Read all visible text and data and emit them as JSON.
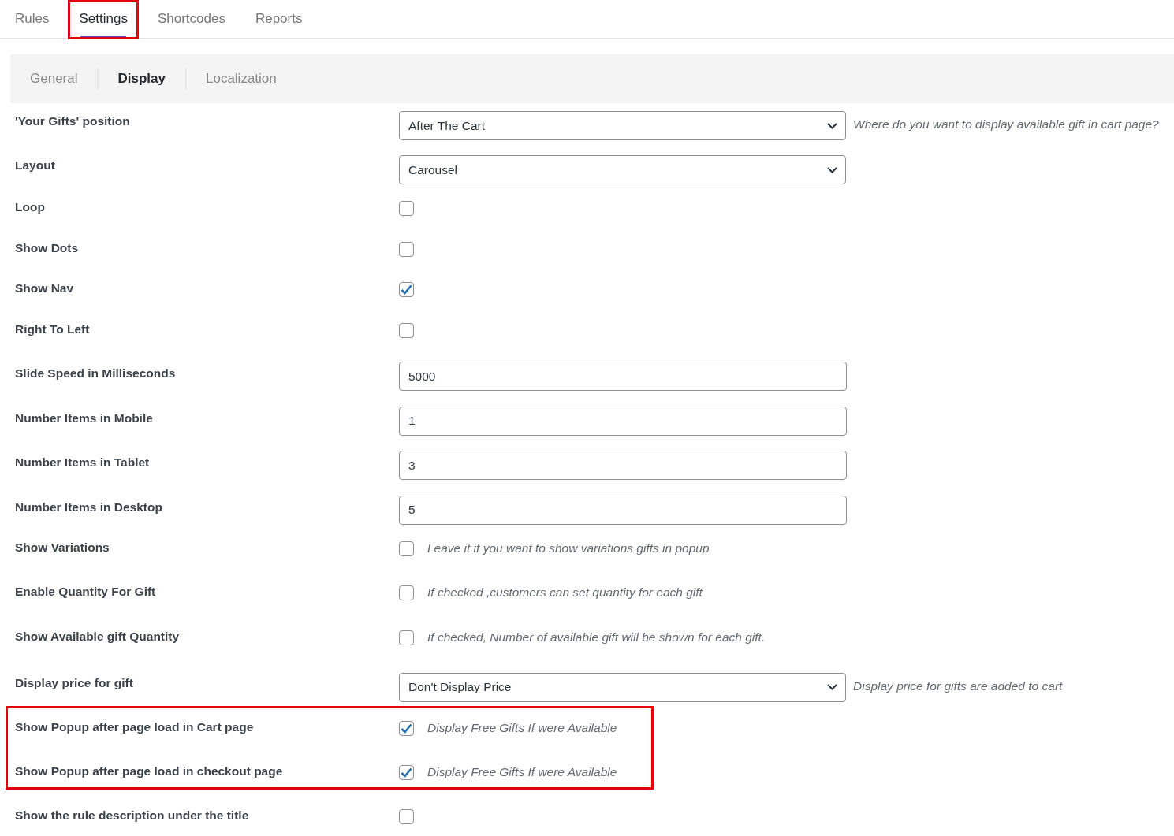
{
  "tabs": [
    {
      "label": "Rules",
      "selected": false,
      "highlighted": false
    },
    {
      "label": "Settings",
      "selected": true,
      "highlighted": true
    },
    {
      "label": "Shortcodes",
      "selected": false,
      "highlighted": false
    },
    {
      "label": "Reports",
      "selected": false,
      "highlighted": false
    }
  ],
  "subtabs": [
    {
      "label": "General",
      "selected": false
    },
    {
      "label": "Display",
      "selected": true
    },
    {
      "label": "Localization",
      "selected": false
    }
  ],
  "sections": [
    {
      "highlighted": false,
      "rows": [
        {
          "kind": "select",
          "label": "'Your Gifts' position",
          "value": "After The Cart",
          "help": "Where do you want to display available gift in cart page?"
        },
        {
          "kind": "select",
          "label": "Layout",
          "value": "Carousel"
        },
        {
          "kind": "checkbox",
          "label": "Loop",
          "checked": false
        },
        {
          "kind": "checkbox",
          "label": "Show Dots",
          "checked": false
        },
        {
          "kind": "checkbox",
          "label": "Show Nav",
          "checked": true
        },
        {
          "kind": "checkbox",
          "label": "Right To Left",
          "checked": false
        },
        {
          "kind": "input",
          "label": "Slide Speed in Milliseconds",
          "value": "5000"
        },
        {
          "kind": "input",
          "label": "Number Items in Mobile",
          "value": "1"
        },
        {
          "kind": "input",
          "label": "Number Items in Tablet",
          "value": "3"
        },
        {
          "kind": "input",
          "label": "Number Items in Desktop",
          "value": "5"
        },
        {
          "kind": "checkbox",
          "label": "Show Variations",
          "checked": false,
          "help": "Leave it if you want to show variations gifts in popup"
        },
        {
          "kind": "checkbox",
          "label": "Enable Quantity For Gift",
          "checked": false,
          "help": "If checked ,customers can set quantity for each gift"
        },
        {
          "kind": "checkbox",
          "label": "Show Available gift Quantity",
          "checked": false,
          "help": "If checked, Number of available gift will be shown for each gift."
        },
        {
          "kind": "select",
          "label": "Display price for gift",
          "value": "Don't Display Price",
          "help": "Display price for gifts are added to cart"
        }
      ]
    },
    {
      "highlighted": true,
      "rows": [
        {
          "kind": "checkbox",
          "label": "Show Popup after page load in Cart page",
          "checked": true,
          "help": "Display Free Gifts If were Available"
        },
        {
          "kind": "checkbox",
          "label": "Show Popup after page load in checkout page",
          "checked": true,
          "help": "Display Free Gifts If were Available"
        }
      ]
    },
    {
      "highlighted": false,
      "rows": [
        {
          "kind": "checkbox",
          "label": "Show the rule description under the title",
          "checked": false
        }
      ]
    }
  ]
}
